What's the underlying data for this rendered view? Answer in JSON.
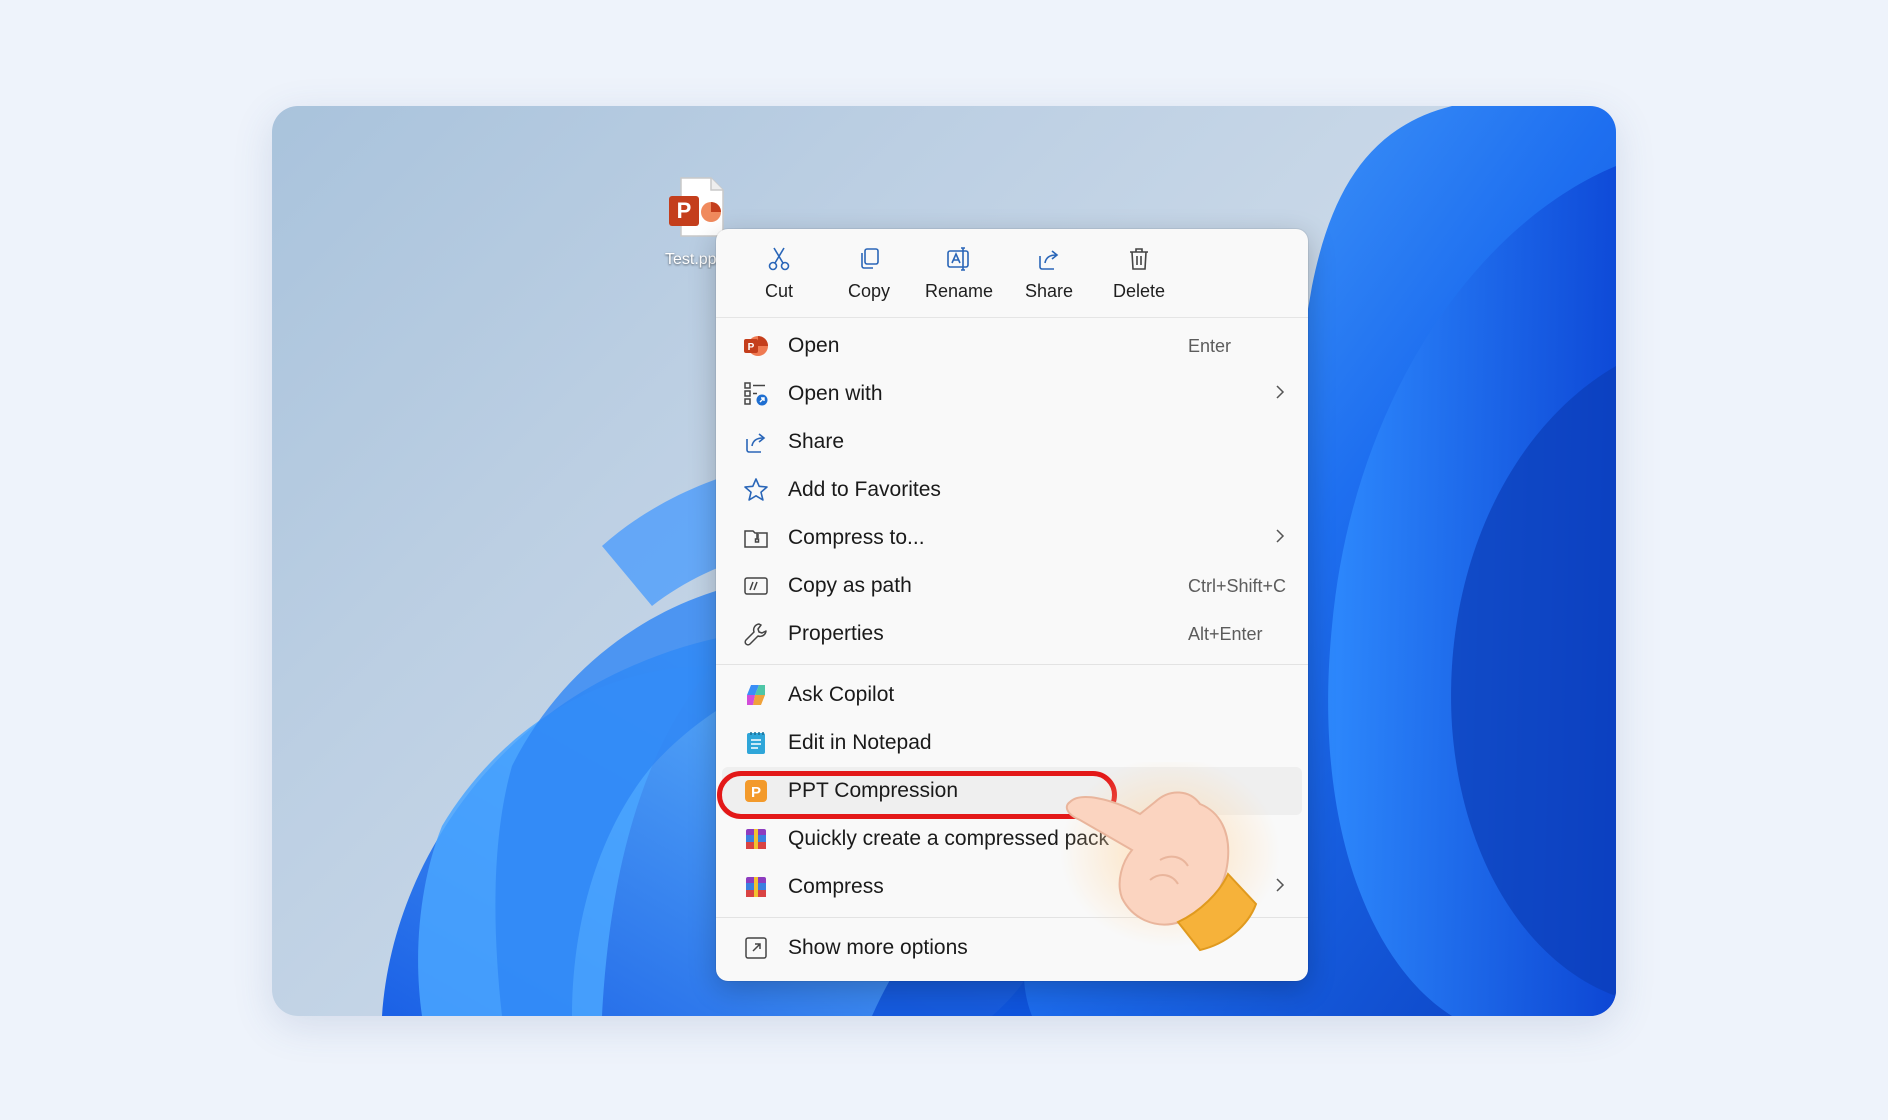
{
  "desktop": {
    "file_label": "Test.pptx"
  },
  "toolbar": {
    "cut": "Cut",
    "copy": "Copy",
    "rename": "Rename",
    "share": "Share",
    "delete": "Delete"
  },
  "menu": {
    "open": {
      "label": "Open",
      "shortcut": "Enter"
    },
    "open_with": {
      "label": "Open with"
    },
    "share": {
      "label": "Share"
    },
    "favorites": {
      "label": "Add to Favorites"
    },
    "compress_to": {
      "label": "Compress to..."
    },
    "copy_path": {
      "label": "Copy as path",
      "shortcut": "Ctrl+Shift+C"
    },
    "properties": {
      "label": "Properties",
      "shortcut": "Alt+Enter"
    },
    "ask_copilot": {
      "label": "Ask Copilot"
    },
    "notepad": {
      "label": "Edit in Notepad"
    },
    "ppt_compression": {
      "label": "PPT Compression"
    },
    "quick_compress": {
      "label": "Quickly create a compressed pack"
    },
    "compress": {
      "label": "Compress"
    },
    "more_options": {
      "label": "Show more options"
    }
  },
  "colors": {
    "accent": "#0067c0",
    "highlight": "#e31818",
    "powerpoint": "#c43e1c"
  }
}
